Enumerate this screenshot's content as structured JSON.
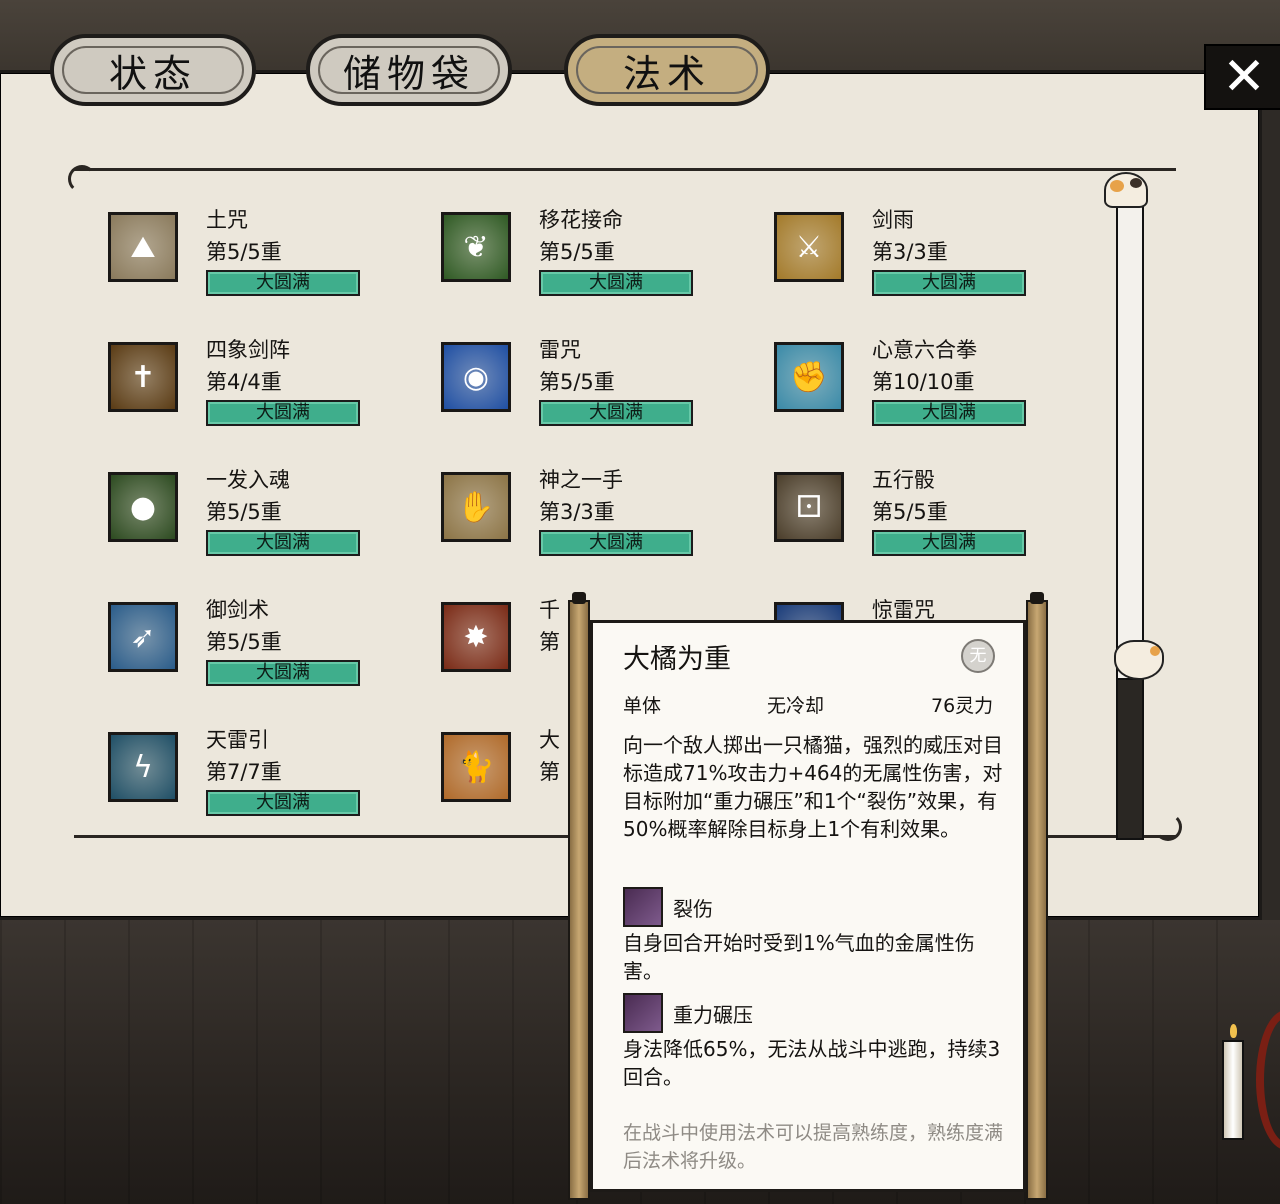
{
  "tabs": [
    {
      "label": "状态"
    },
    {
      "label": "储物袋"
    },
    {
      "label": "法术",
      "active": true
    }
  ],
  "close_icon": "close-icon",
  "spells": [
    {
      "name": "土咒",
      "level": "第5/5重",
      "badge": "大圆满",
      "icon": "earth-curse-icon",
      "color": "#8a7a5c"
    },
    {
      "name": "移花接命",
      "level": "第5/5重",
      "badge": "大圆满",
      "icon": "vine-icon",
      "color": "#2f5a24"
    },
    {
      "name": "剑雨",
      "level": "第3/3重",
      "badge": "大圆满",
      "icon": "sword-rain-icon",
      "color": "#a37a2a"
    },
    {
      "name": "四象剑阵",
      "level": "第4/4重",
      "badge": "大圆满",
      "icon": "sword-formation-icon",
      "color": "#5a3b14"
    },
    {
      "name": "雷咒",
      "level": "第5/5重",
      "badge": "大圆满",
      "icon": "lightning-orb-icon",
      "color": "#1f4fa3"
    },
    {
      "name": "心意六合拳",
      "level": "第10/10重",
      "badge": "大圆满",
      "icon": "fist-icon",
      "color": "#3a8aa8"
    },
    {
      "name": "一发入魂",
      "level": "第5/5重",
      "badge": "大圆满",
      "icon": "green-orbs-icon",
      "color": "#2c4a20"
    },
    {
      "name": "神之一手",
      "level": "第3/3重",
      "badge": "大圆满",
      "icon": "divine-hand-icon",
      "color": "#8c7446"
    },
    {
      "name": "五行骰",
      "level": "第5/5重",
      "badge": "大圆满",
      "icon": "dice-icon",
      "color": "#4a3d2a"
    },
    {
      "name": "御剑术",
      "level": "第5/5重",
      "badge": "大圆满",
      "icon": "flying-sword-icon",
      "color": "#2a5c8a"
    },
    {
      "name": "千",
      "level": "第",
      "badge": "",
      "icon": "burst-icon",
      "color": "#7a2a16"
    },
    {
      "name": "惊雷咒",
      "level": "",
      "badge": "",
      "icon": "thunder-icon",
      "color": "#1a3c7a"
    },
    {
      "name": "天雷引",
      "level": "第7/7重",
      "badge": "大圆满",
      "icon": "thunder-summon-icon",
      "color": "#1f4f66"
    },
    {
      "name": "大",
      "level": "第",
      "badge": "",
      "icon": "orange-cat-icon",
      "color": "#b06a2a"
    }
  ],
  "tooltip": {
    "title": "大橘为重",
    "element_badge": "无",
    "target": "单体",
    "cooldown": "无冷却",
    "cost": "76灵力",
    "description": "向一个敌人掷出一只橘猫，强烈的威压对目标造成71%攻击力+464的无属性伤害，对目标附加“重力碾压”和1个“裂伤”效果，有50%概率解除目标身上1个有利效果。",
    "effects": [
      {
        "name": "裂伤",
        "icon": "wound-icon",
        "description": "自身回合开始时受到1%气血的金属性伤害。"
      },
      {
        "name": "重力碾压",
        "icon": "gravity-crush-icon",
        "description": "身法降低65%，无法从战斗中逃跑，持续3回合。"
      }
    ],
    "footer": "在战斗中使用法术可以提高熟练度，熟练度满后法术将升级。"
  }
}
